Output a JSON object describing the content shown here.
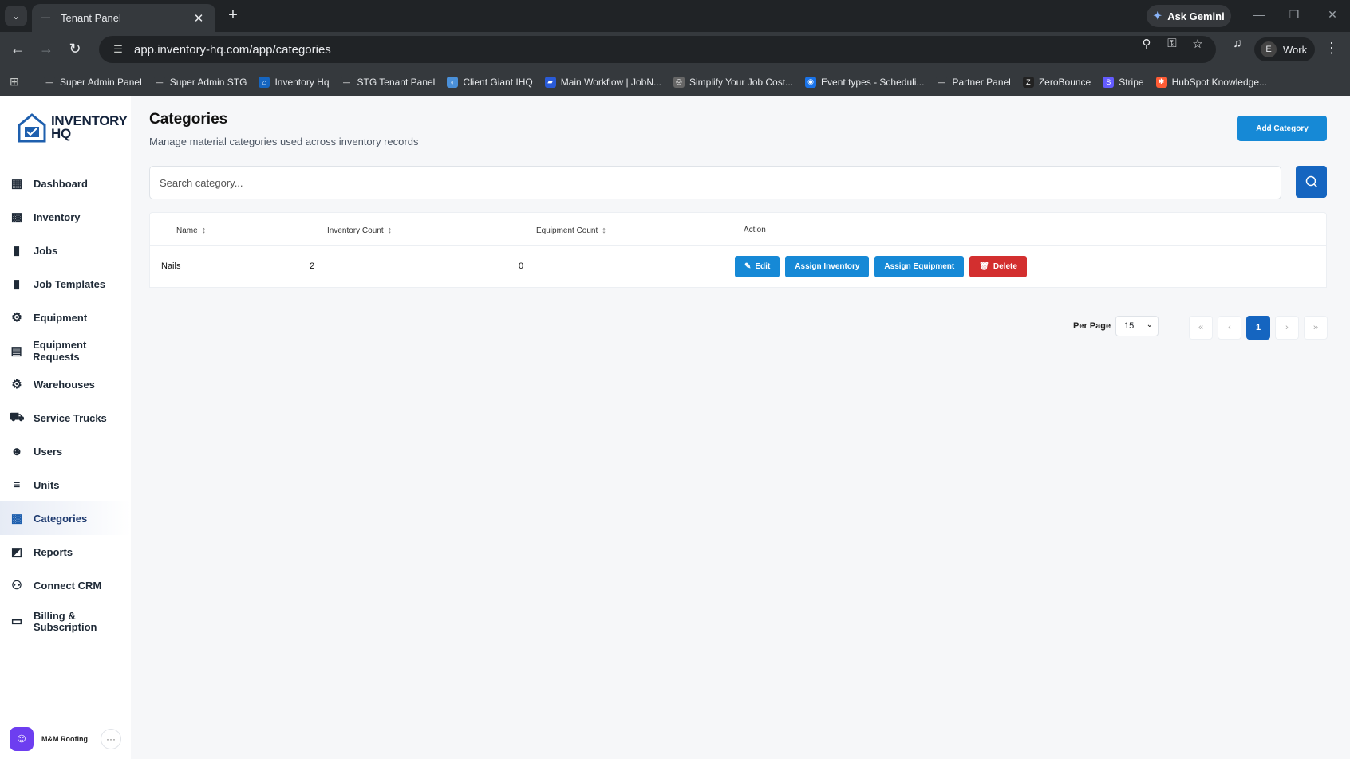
{
  "browser": {
    "tab_title": "Tenant Panel",
    "gemini_label": "Ask Gemini",
    "url": "app.inventory-hq.com/app/categories",
    "profile_initial": "E",
    "profile_label": "Work",
    "bookmarks": [
      {
        "label": "Super Admin Panel",
        "color": "#35393d",
        "glyph": "—"
      },
      {
        "label": "Super Admin STG",
        "color": "#35393d",
        "glyph": "—"
      },
      {
        "label": "Inventory Hq",
        "color": "#1565c0",
        "glyph": "⌂"
      },
      {
        "label": "STG Tenant Panel",
        "color": "#35393d",
        "glyph": "—"
      },
      {
        "label": "Client Giant IHQ",
        "color": "#4a90d9",
        "glyph": "◐"
      },
      {
        "label": "Main Workflow | JobN...",
        "color": "#2a5bd7",
        "glyph": "▰"
      },
      {
        "label": "Simplify Your Job Cost...",
        "color": "#666666",
        "glyph": "◎"
      },
      {
        "label": "Event types - Scheduli...",
        "color": "#1a73e8",
        "glyph": "◉"
      },
      {
        "label": "Partner Panel",
        "color": "#35393d",
        "glyph": "—"
      },
      {
        "label": "ZeroBounce",
        "color": "#222222",
        "glyph": "Z"
      },
      {
        "label": "Stripe",
        "color": "#635bff",
        "glyph": "S"
      },
      {
        "label": "HubSpot Knowledge...",
        "color": "#ff5c35",
        "glyph": "✱"
      }
    ]
  },
  "brand": {
    "line1": "INVENTORY",
    "line2": "HQ"
  },
  "sidebar": {
    "items": [
      {
        "label": "Dashboard",
        "icon": "dashboard-icon",
        "glyph": "▦"
      },
      {
        "label": "Inventory",
        "icon": "inventory-icon",
        "glyph": "▩"
      },
      {
        "label": "Jobs",
        "icon": "jobs-icon",
        "glyph": "▮"
      },
      {
        "label": "Job Templates",
        "icon": "job-templates-icon",
        "glyph": "▮"
      },
      {
        "label": "Equipment",
        "icon": "equipment-icon",
        "glyph": "⚙"
      },
      {
        "label": "Equipment Requests",
        "icon": "equipment-requests-icon",
        "glyph": "▤"
      },
      {
        "label": "Warehouses",
        "icon": "warehouses-icon",
        "glyph": "⚙"
      },
      {
        "label": "Service Trucks",
        "icon": "service-trucks-icon",
        "glyph": "⛟"
      },
      {
        "label": "Users",
        "icon": "users-icon",
        "glyph": "☻"
      },
      {
        "label": "Units",
        "icon": "units-icon",
        "glyph": "≡"
      },
      {
        "label": "Categories",
        "icon": "categories-icon",
        "glyph": "▩"
      },
      {
        "label": "Reports",
        "icon": "reports-icon",
        "glyph": "◩"
      },
      {
        "label": "Connect CRM",
        "icon": "connect-crm-icon",
        "glyph": "⚇"
      }
    ],
    "billing_line1": "Billing &",
    "billing_line2": "Subscription",
    "active": "Categories",
    "org_name": "M&M Roofing"
  },
  "page": {
    "title": "Categories",
    "subtitle": "Manage material categories used across inventory records",
    "add_button": "Add Category",
    "search_placeholder": "Search category..."
  },
  "table": {
    "headers": [
      "Name",
      "Inventory Count",
      "Equipment Count",
      "Action"
    ],
    "rows": [
      {
        "name": "Nails",
        "inventory_count": "2",
        "equipment_count": "0"
      }
    ],
    "actions": {
      "edit": "Edit",
      "assign_inventory": "Assign Inventory",
      "assign_equipment": "Assign Equipment",
      "delete": "Delete"
    }
  },
  "pagination": {
    "per_page_label": "Per Page",
    "per_page_value": "15",
    "first": "«",
    "prev": "‹",
    "current": "1",
    "next": "›",
    "last": "»"
  },
  "colors": {
    "primary": "#1689d6",
    "primary_dark": "#1565c0",
    "danger": "#d32f2f"
  }
}
